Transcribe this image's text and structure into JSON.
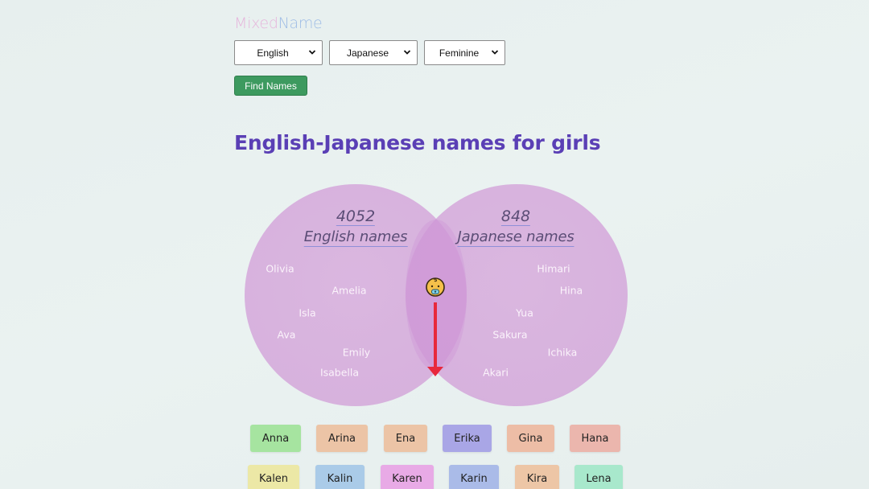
{
  "app": {
    "logo_part1": "Mixed",
    "logo_part2": "Name"
  },
  "filters": {
    "language1": "English",
    "language2": "Japanese",
    "gender": "Feminine",
    "find_button": "Find Names"
  },
  "page_title": "English-Japanese names for girls",
  "venn": {
    "left": {
      "count": "4052",
      "label": "English names",
      "names": [
        "Olivia",
        "Amelia",
        "Isla",
        "Ava",
        "Emily",
        "Isabella"
      ]
    },
    "right": {
      "count": "848",
      "label": "Japanese names",
      "names": [
        "Himari",
        "Hina",
        "Yua",
        "Sakura",
        "Ichika",
        "Akari"
      ]
    },
    "overlap_icon": "baby-icon",
    "arrow_icon": "arrow-down-icon",
    "arrow_color": "#e8283c"
  },
  "results": {
    "names": [
      {
        "label": "Anna",
        "color": "#a6e4a0"
      },
      {
        "label": "Arina",
        "color": "#ecc4a6"
      },
      {
        "label": "Ena",
        "color": "#ecc4a6"
      },
      {
        "label": "Erika",
        "color": "#a9a6e6"
      },
      {
        "label": "Gina",
        "color": "#edbda6"
      },
      {
        "label": "Hana",
        "color": "#ebb6ad"
      },
      {
        "label": "Kalen",
        "color": "#ece8a6"
      },
      {
        "label": "Kalin",
        "color": "#aacbe8"
      },
      {
        "label": "Karen",
        "color": "#e8aae6"
      },
      {
        "label": "Karin",
        "color": "#aabbe8"
      },
      {
        "label": "Kira",
        "color": "#edc6a6"
      },
      {
        "label": "Lena",
        "color": "#a8e8cc"
      }
    ]
  },
  "colors": {
    "title": "#5a3fb5",
    "find_button": "#3d9a5f"
  }
}
